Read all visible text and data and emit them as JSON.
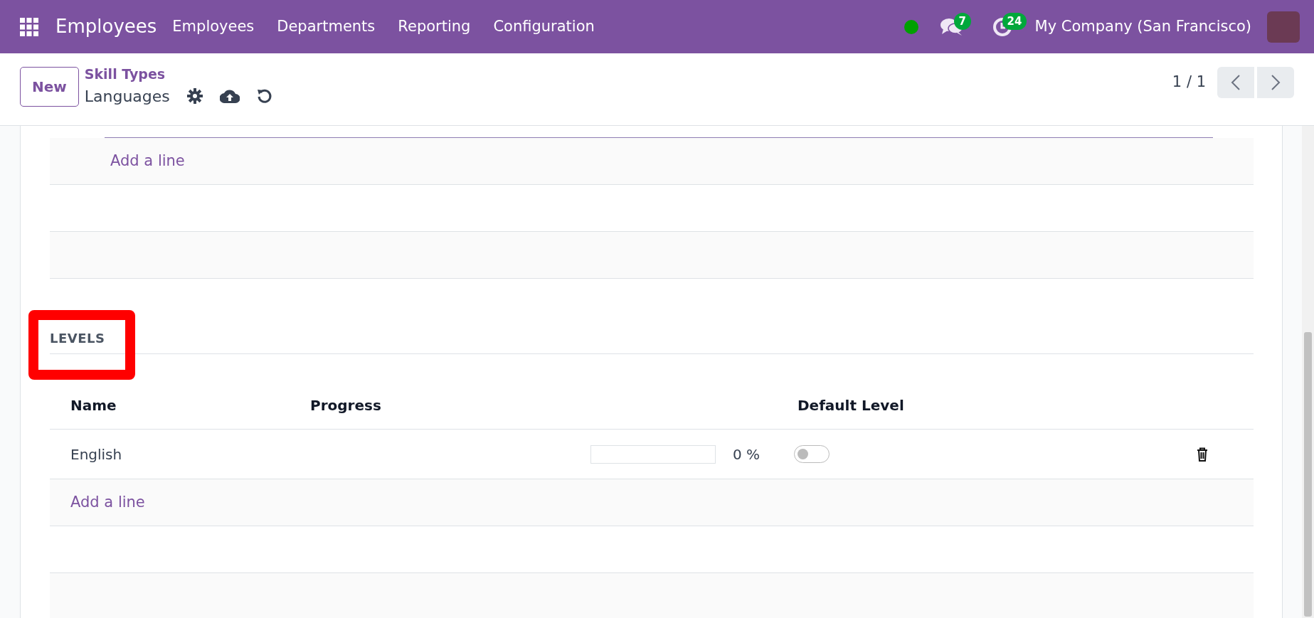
{
  "navbar": {
    "app_title": "Employees",
    "menu": [
      "Employees",
      "Departments",
      "Reporting",
      "Configuration"
    ],
    "messages_count": "7",
    "activities_count": "24",
    "company": "My Company (San Francisco)"
  },
  "control_panel": {
    "new_button": "New",
    "breadcrumb_parent": "Skill Types",
    "record_title": "Languages",
    "pager": "1 / 1"
  },
  "skills_list": {
    "add_line": "Add a line"
  },
  "levels": {
    "title": "LEVELS",
    "highlighted": true,
    "columns": [
      "Name",
      "Progress",
      "Default Level"
    ],
    "rows": [
      {
        "name": "English",
        "level": 0,
        "reading": "0 %",
        "default_level": false
      }
    ],
    "add_line": "Add a line"
  }
}
